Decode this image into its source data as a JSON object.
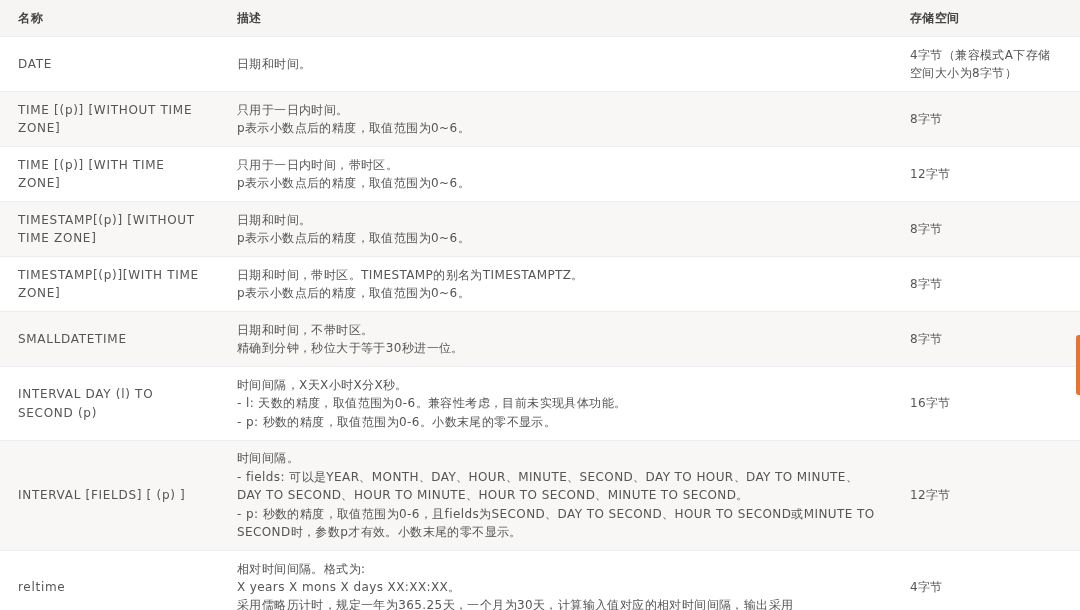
{
  "table": {
    "columns": [
      "名称",
      "描述",
      "存储空间"
    ],
    "rows": [
      {
        "name": "DATE",
        "description": [
          "日期和时间。"
        ],
        "storage": "4字节（兼容模式A下存储空间大小为8字节）"
      },
      {
        "name": "TIME [(p)] [WITHOUT TIME ZONE]",
        "description": [
          "只用于一日内时间。",
          "p表示小数点后的精度，取值范围为0~6。"
        ],
        "storage": "8字节"
      },
      {
        "name": "TIME [(p)] [WITH TIME ZONE]",
        "description": [
          "只用于一日内时间，带时区。",
          "p表示小数点后的精度，取值范围为0~6。"
        ],
        "storage": "12字节"
      },
      {
        "name": "TIMESTAMP[(p)] [WITHOUT TIME ZONE]",
        "description": [
          "日期和时间。",
          "p表示小数点后的精度，取值范围为0~6。"
        ],
        "storage": "8字节"
      },
      {
        "name": "TIMESTAMP[(p)][WITH TIME ZONE]",
        "description": [
          "日期和时间，带时区。TIMESTAMP的别名为TIMESTAMPTZ。",
          "p表示小数点后的精度，取值范围为0~6。"
        ],
        "storage": "8字节"
      },
      {
        "name": "SMALLDATETIME",
        "description": [
          "日期和时间，不带时区。",
          "精确到分钟，秒位大于等于30秒进一位。"
        ],
        "storage": "8字节"
      },
      {
        "name": "INTERVAL DAY (l) TO SECOND (p)",
        "description": [
          "时间间隔，X天X小时X分X秒。",
          "- l: 天数的精度，取值范围为0-6。兼容性考虑，目前未实现具体功能。",
          "- p: 秒数的精度，取值范围为0-6。小数末尾的零不显示。"
        ],
        "storage": "16字节"
      },
      {
        "name": "INTERVAL [FIELDS] [ (p) ]",
        "description": [
          "时间间隔。",
          "- fields: 可以是YEAR、MONTH、DAY、HOUR、MINUTE、SECOND、DAY TO HOUR、DAY TO MINUTE、DAY TO SECOND、HOUR TO MINUTE、HOUR TO SECOND、MINUTE TO SECOND。",
          "- p: 秒数的精度，取值范围为0-6，且fields为SECOND、DAY TO SECOND、HOUR TO SECOND或MINUTE TO SECOND时，参数p才有效。小数末尾的零不显示。"
        ],
        "storage": "12字节"
      },
      {
        "name": "reltime",
        "description": [
          "相对时间间隔。格式为:",
          "X years X mons X days XX:XX:XX。",
          "采用儒略历计时，规定一年为365.25天，一个月为30天，计算输入值对应的相对时间间隔，输出采用"
        ],
        "storage": "4字节"
      }
    ]
  },
  "side_tab": {
    "kind": "tab"
  }
}
